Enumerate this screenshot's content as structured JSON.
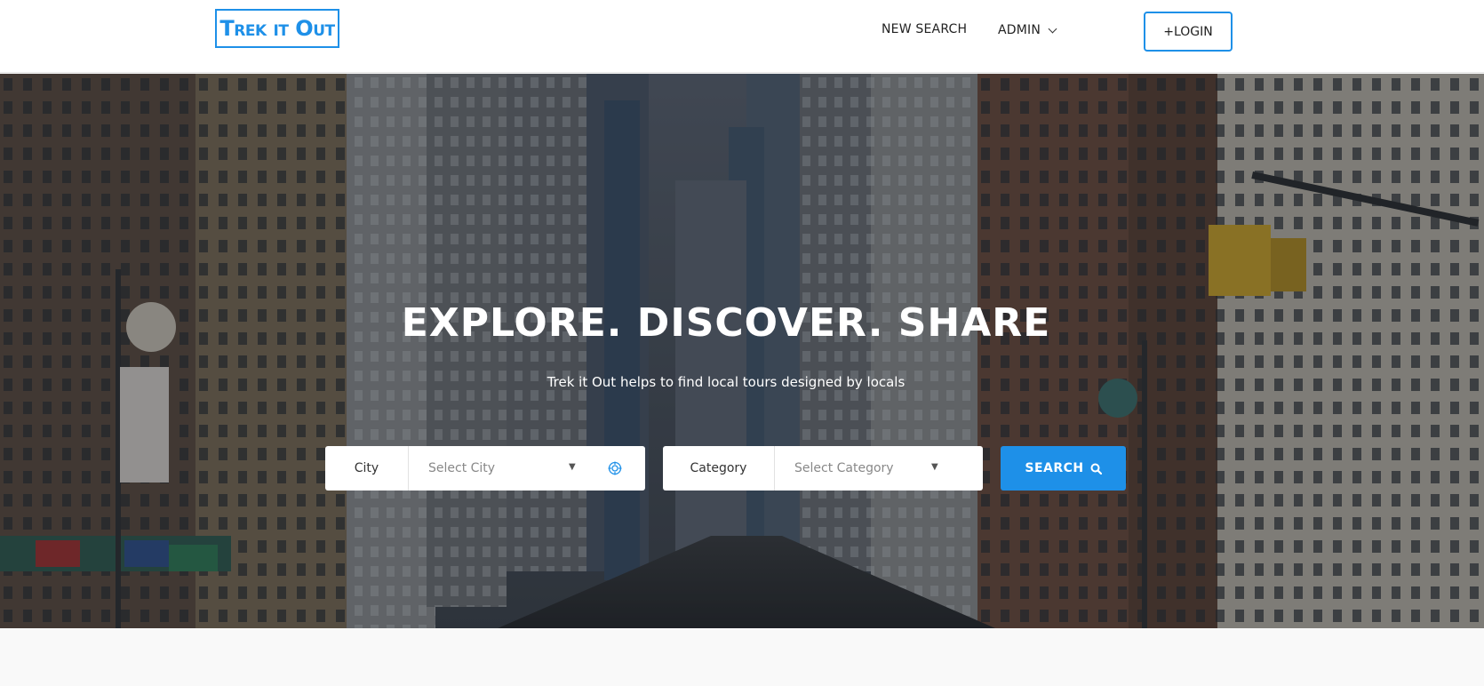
{
  "header": {
    "logo_text": "Trek it Out",
    "nav": {
      "new_search": "NEW SEARCH",
      "admin": "ADMIN"
    },
    "login_label": "+LOGIN"
  },
  "hero": {
    "title": "EXPLORE. DISCOVER. SHARE",
    "subtitle": "Trek it Out helps to find local tours designed by locals",
    "city": {
      "label": "City",
      "placeholder": "Select City"
    },
    "category": {
      "label": "Category",
      "placeholder": "Select Category"
    },
    "search_label": "SEARCH"
  },
  "colors": {
    "accent": "#1e90e8",
    "header_bg": "#ffffff",
    "page_bg": "#f9f9f9"
  },
  "icons": {
    "dropdown": "chevron-down-icon",
    "locate": "locate-icon",
    "search": "search-icon",
    "caret": "caret-down-icon"
  }
}
